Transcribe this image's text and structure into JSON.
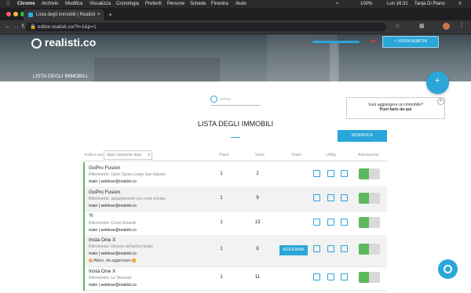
{
  "menubar": {
    "apple": "",
    "items": [
      "Chrome",
      "Archivio",
      "Modifica",
      "Visualizza",
      "Cronologia",
      "Preferiti",
      "Persone",
      "Scheda",
      "Finestra",
      "Aiuto"
    ],
    "battery": "100%",
    "clock": "Lun 16:31",
    "user": "Tanja Di Piano"
  },
  "browser": {
    "tab_title": "Lista degli immobili | Realisti.co",
    "url": "editor.realisti.co/?l=1&p=1"
  },
  "banner": {
    "logo_text": "realisti.co",
    "remote_button": "VISITA REMOTA",
    "page_heading": "LISTA DEGLI IMMOBILI"
  },
  "search": {
    "placeholder": "cerca..."
  },
  "tooltip": {
    "line1": "Vuoi aggiungere un immobile?",
    "line2": "Puoi farlo da qui"
  },
  "main": {
    "title": "LISTA DEGLI IMMOBILI",
    "modify_button": "MODIFICA",
    "sort_label": "ordina per",
    "sort_value": "data creazione desc"
  },
  "columns": {
    "piani": "Piani",
    "viste": "Viste",
    "stato": "Stato",
    "utility": "Utility",
    "attivazione": "Attivazione"
  },
  "rows": [
    {
      "name": "GoPro Fusion",
      "ref": "Riferimento: Open Space Largo San Nazaro",
      "account": "main | webinar@realisti.co",
      "status": "",
      "piani": "1",
      "viste": "2",
      "update": ""
    },
    {
      "name": "GoPro Fusion",
      "ref": "Riferimento: appartamento con corte privata",
      "account": "main | webinar@realisti.co",
      "status": "",
      "piani": "1",
      "viste": "9",
      "update": ""
    },
    {
      "name": "Yi",
      "ref": "Riferimento: Corso Einaudi",
      "account": "main | webinar@realisti.co",
      "status": "",
      "piani": "1",
      "viste": "13",
      "update": ""
    },
    {
      "name": "Insta One X",
      "ref": "Riferimento: Dimora nell'antico borgo",
      "account": "main | webinar@realisti.co",
      "status": "Attivo, da aggiornare",
      "piani": "1",
      "viste": "8",
      "update": "AGGIORNA"
    },
    {
      "name": "Insta One X",
      "ref": "Riferimento: Le Terrazze",
      "account": "main | webinar@realisti.co",
      "status": "",
      "piani": "1",
      "viste": "11",
      "update": ""
    }
  ],
  "icons": {
    "play": "play-icon",
    "image": "image-icon",
    "external": "external-link-icon",
    "chat": "chat-icon",
    "plus": "plus-icon",
    "search": "search-icon"
  },
  "colors": {
    "accent": "#2aa6d8",
    "active": "#5cb85c",
    "menubar": "#2b2b2d"
  }
}
